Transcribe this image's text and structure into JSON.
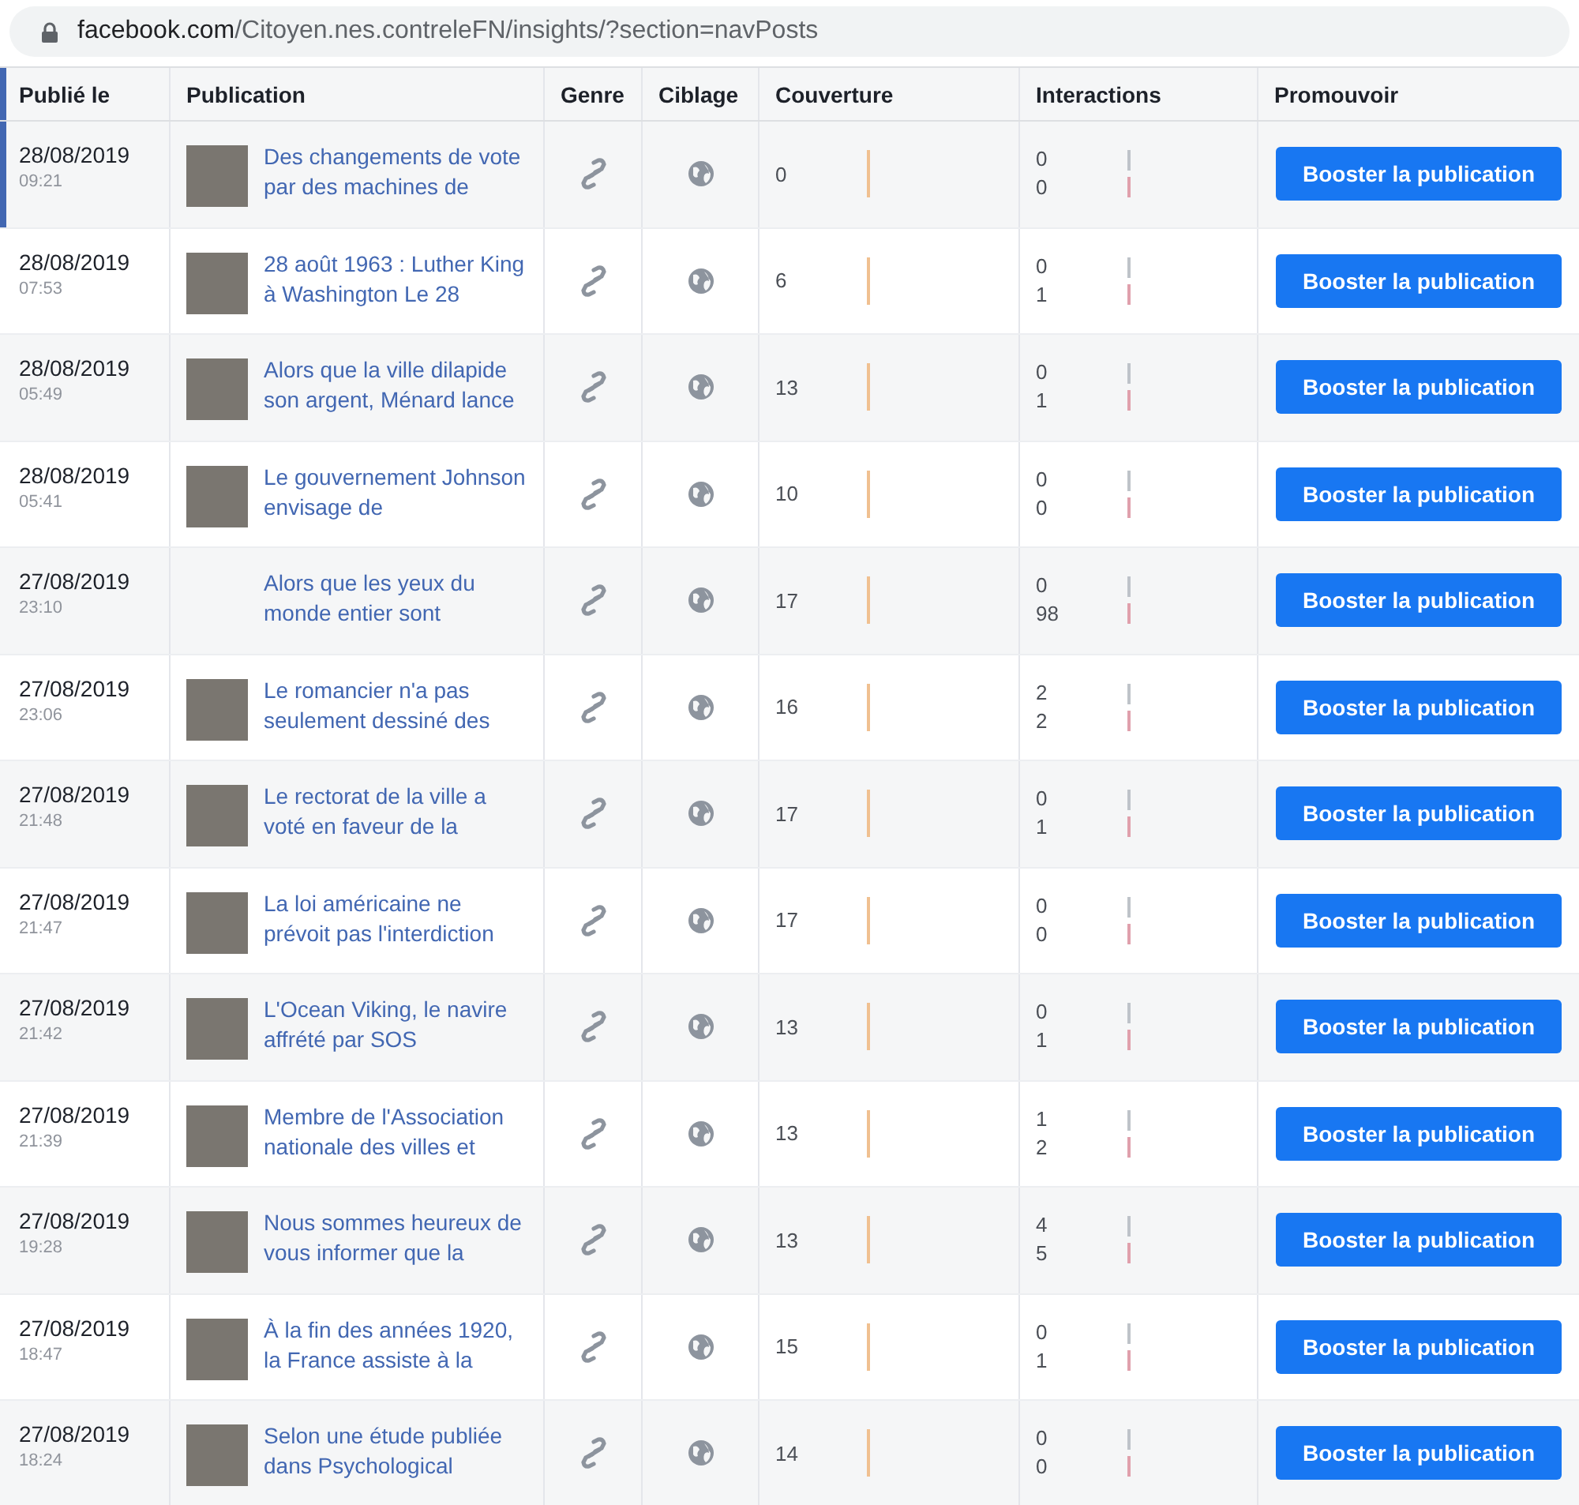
{
  "address_bar": {
    "domain": "facebook.com",
    "path": "/Citoyen.nes.contreleFN/insights/?section=navPosts"
  },
  "table": {
    "columns": [
      "Publié le",
      "Publication",
      "Genre",
      "Ciblage",
      "Couverture",
      "Interactions",
      "Promouvoir"
    ],
    "rows": [
      {
        "date": "28/08/2019",
        "time": "09:21",
        "thumbnail": true,
        "text": "Des changements de vote par des machines de",
        "reach": "0",
        "interactions": [
          "0",
          "0"
        ],
        "button": "Booster la publication"
      },
      {
        "date": "28/08/2019",
        "time": "07:53",
        "thumbnail": true,
        "text": "28 août 1963 : Luther King à Washington Le 28",
        "reach": "6",
        "interactions": [
          "0",
          "1"
        ],
        "button": "Booster la publication"
      },
      {
        "date": "28/08/2019",
        "time": "05:49",
        "thumbnail": true,
        "text": "Alors que la ville dilapide son argent, Ménard lance",
        "reach": "13",
        "interactions": [
          "0",
          "1"
        ],
        "button": "Booster la publication"
      },
      {
        "date": "28/08/2019",
        "time": "05:41",
        "thumbnail": true,
        "text": "Le gouvernement Johnson envisage de",
        "reach": "10",
        "interactions": [
          "0",
          "0"
        ],
        "button": "Booster la publication"
      },
      {
        "date": "27/08/2019",
        "time": "23:10",
        "thumbnail": false,
        "text": "Alors que les yeux du monde entier sont",
        "reach": "17",
        "interactions": [
          "0",
          "98"
        ],
        "button": "Booster la publication"
      },
      {
        "date": "27/08/2019",
        "time": "23:06",
        "thumbnail": true,
        "text": "Le romancier n'a pas seulement dessiné des",
        "reach": "16",
        "interactions": [
          "2",
          "2"
        ],
        "button": "Booster la publication"
      },
      {
        "date": "27/08/2019",
        "time": "21:48",
        "thumbnail": true,
        "text": "Le rectorat de la ville a voté en faveur de la",
        "reach": "17",
        "interactions": [
          "0",
          "1"
        ],
        "button": "Booster la publication"
      },
      {
        "date": "27/08/2019",
        "time": "21:47",
        "thumbnail": true,
        "text": "La loi américaine ne prévoit pas l'interdiction",
        "reach": "17",
        "interactions": [
          "0",
          "0"
        ],
        "button": "Booster la publication"
      },
      {
        "date": "27/08/2019",
        "time": "21:42",
        "thumbnail": true,
        "text": "L'Ocean Viking, le navire affrété par SOS",
        "reach": "13",
        "interactions": [
          "0",
          "1"
        ],
        "button": "Booster la publication"
      },
      {
        "date": "27/08/2019",
        "time": "21:39",
        "thumbnail": true,
        "text": "Membre de l'Association nationale des villes et",
        "reach": "13",
        "interactions": [
          "1",
          "2"
        ],
        "button": "Booster la publication"
      },
      {
        "date": "27/08/2019",
        "time": "19:28",
        "thumbnail": true,
        "text": "Nous sommes heureux de vous informer que la",
        "reach": "13",
        "interactions": [
          "4",
          "5"
        ],
        "button": "Booster la publication"
      },
      {
        "date": "27/08/2019",
        "time": "18:47",
        "thumbnail": true,
        "text": "À la fin des années 1920, la France assiste à la",
        "reach": "15",
        "interactions": [
          "0",
          "1"
        ],
        "button": "Booster la publication"
      },
      {
        "date": "27/08/2019",
        "time": "18:24",
        "thumbnail": true,
        "text": "Selon une étude publiée dans Psychological",
        "reach": "14",
        "interactions": [
          "0",
          "0"
        ],
        "button": "Booster la publication"
      }
    ]
  }
}
